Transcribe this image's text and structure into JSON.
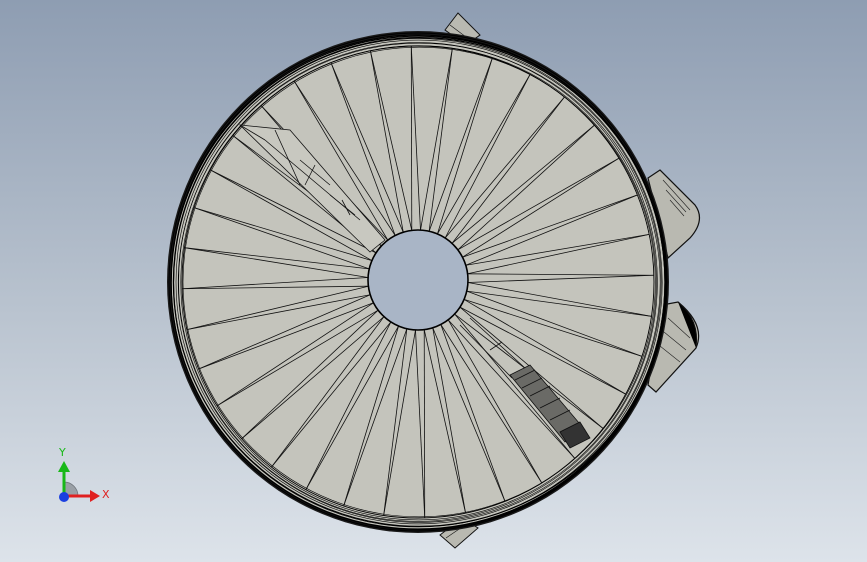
{
  "viewport": {
    "icon": "cad-3d-model",
    "colors": {
      "background_top": "#8e9db2",
      "background_bottom": "#dde3ea",
      "face": "#c4c4bc",
      "edge": "#000000",
      "hole": "#a9b5c6"
    }
  },
  "triad": {
    "x_label": "X",
    "y_label": "Y",
    "colors": {
      "x": "#e02020",
      "y": "#18b818",
      "z": "#1a3fe0"
    }
  }
}
